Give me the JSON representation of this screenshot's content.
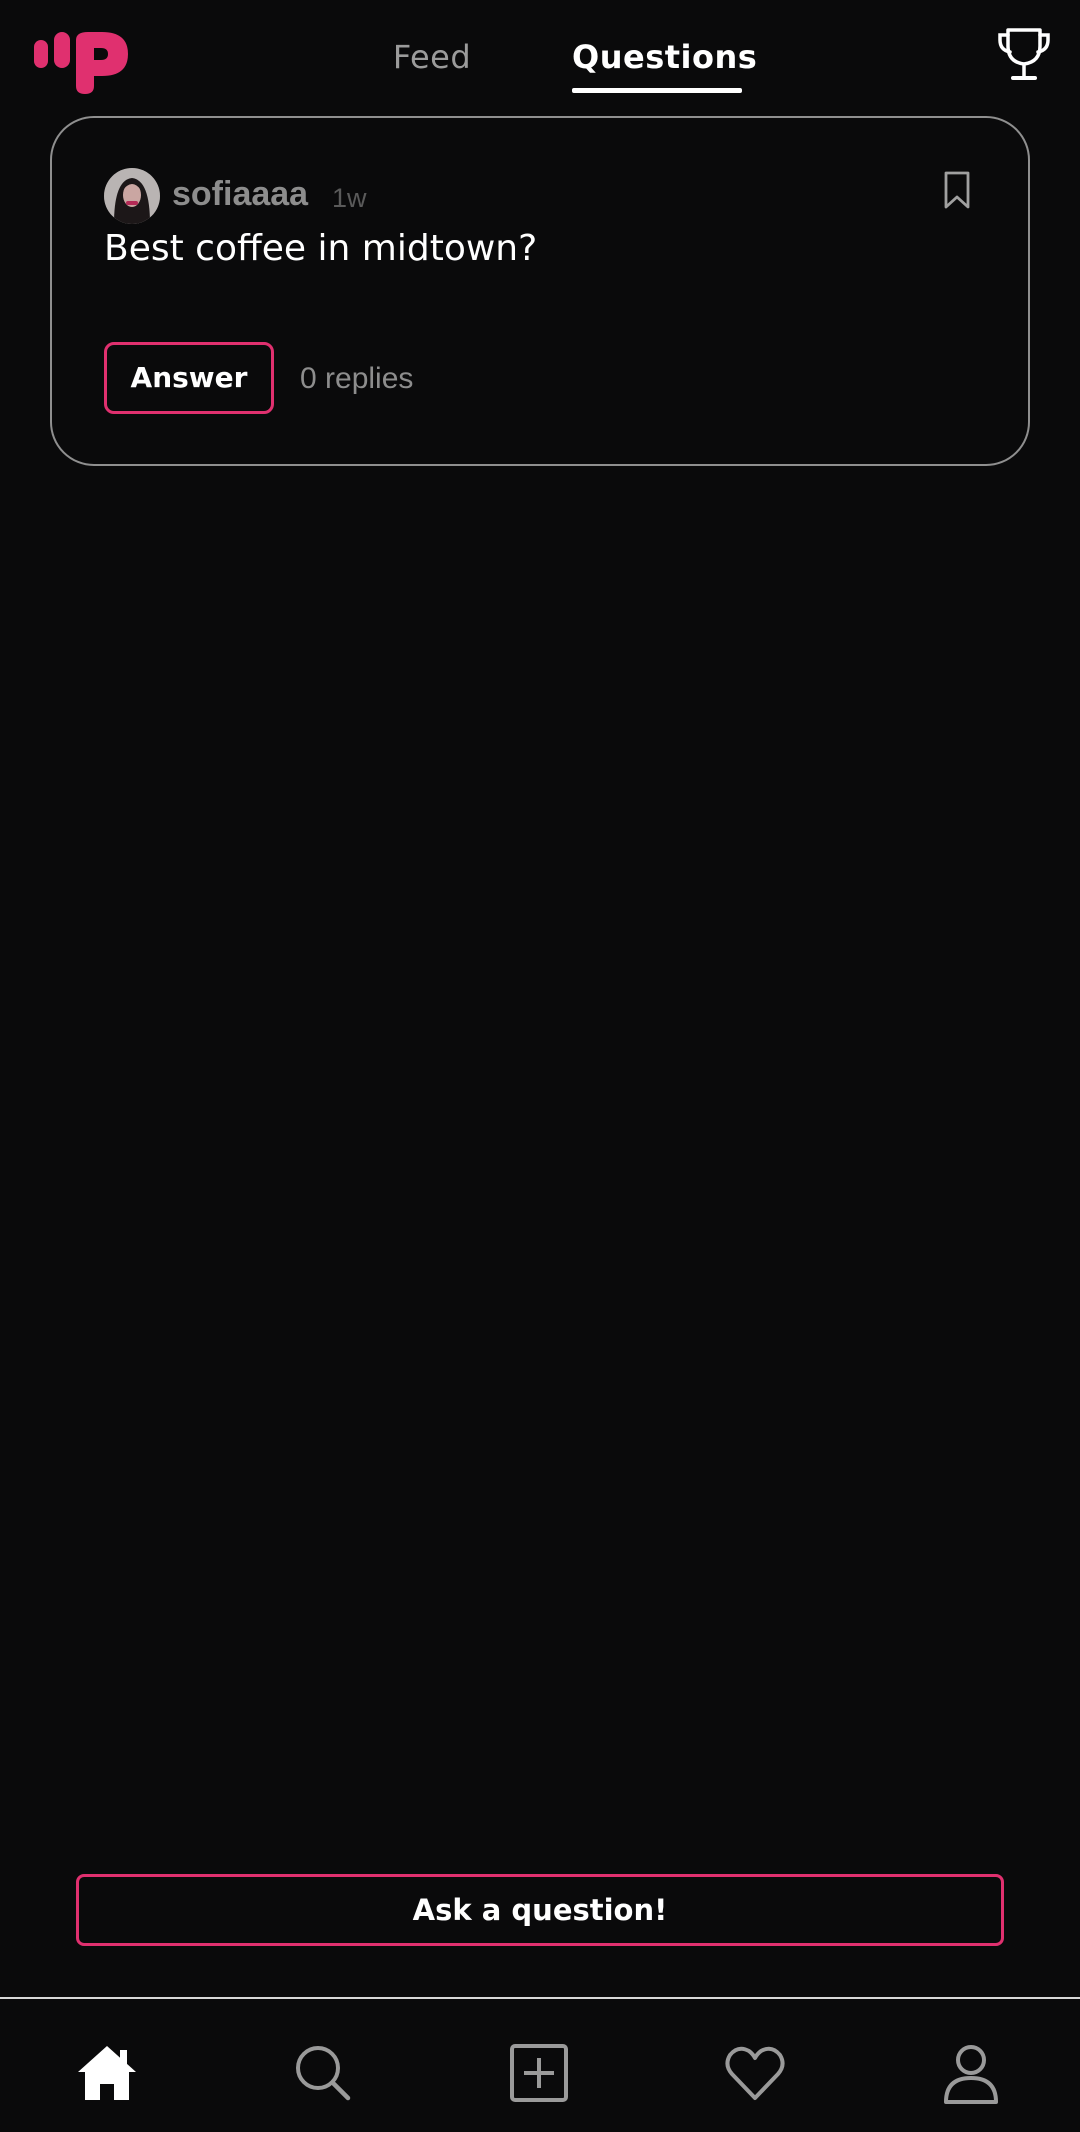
{
  "header": {
    "logo_icon": "app-logo",
    "tabs": [
      {
        "label": "Feed",
        "active": false
      },
      {
        "label": "Questions",
        "active": true
      }
    ],
    "trophy_icon": "trophy-icon"
  },
  "question": {
    "username": "sofiaaaa",
    "time": "1w",
    "text": "Best coffee in midtown?",
    "answer_label": "Answer",
    "replies": "0 replies",
    "bookmark_icon": "bookmark-icon"
  },
  "ask_button_label": "Ask a question!",
  "bottom_nav": [
    {
      "icon": "home-icon",
      "active": true
    },
    {
      "icon": "search-icon",
      "active": false
    },
    {
      "icon": "add-post-icon",
      "active": false
    },
    {
      "icon": "heart-icon",
      "active": false
    },
    {
      "icon": "profile-icon",
      "active": false
    }
  ],
  "colors": {
    "background": "#0a0a0b",
    "accent": "#e0306f",
    "muted_text": "#8d8d8d"
  }
}
